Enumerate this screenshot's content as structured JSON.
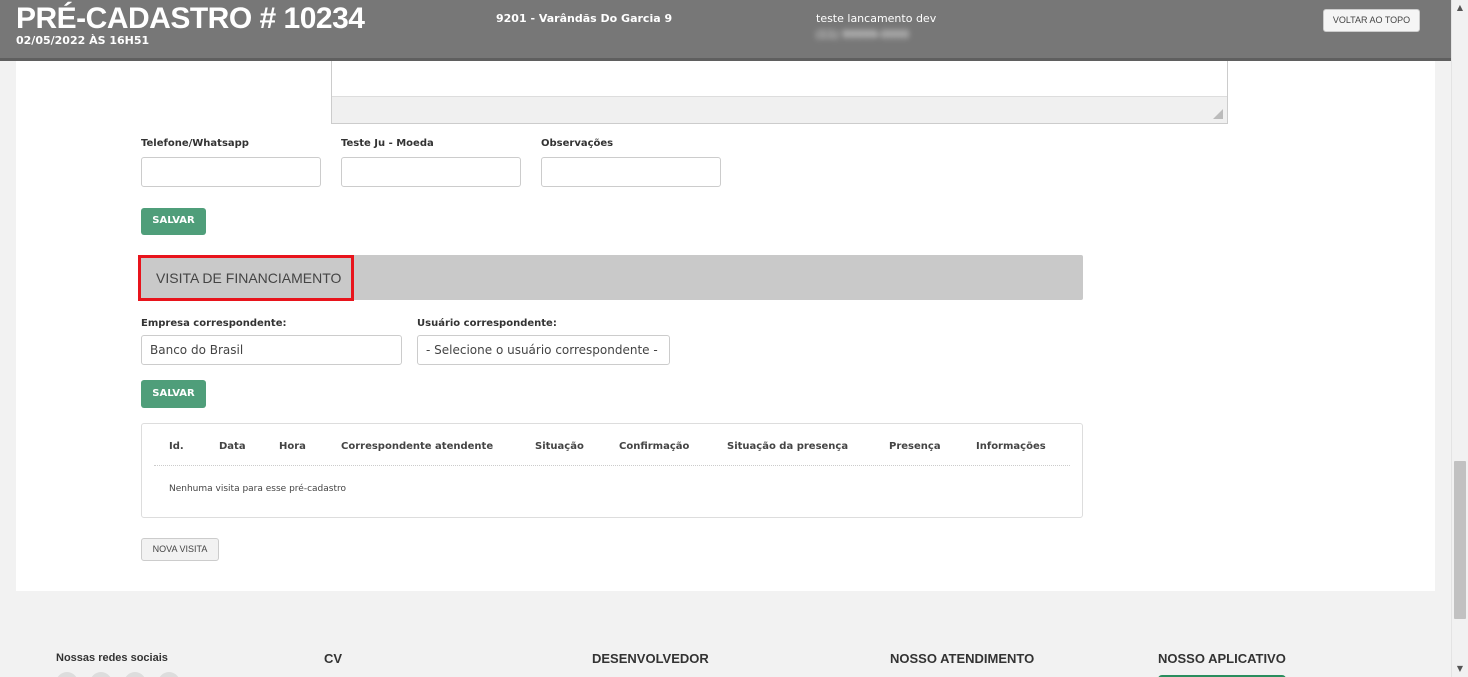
{
  "header": {
    "title": "PRÉ-CADASTRO # 10234",
    "date": "02/05/2022 ÀS 16H51",
    "empreendimento": "9201 - Varândãs Do Garcia 9",
    "client_name": "teste lancamento dev",
    "client_phone": "(11) 99999-0000",
    "back_to_top": "VOLTAR AO TOPO"
  },
  "form": {
    "fields": [
      {
        "label": "Telefone/Whatsapp",
        "value": ""
      },
      {
        "label": "Teste Ju - Moeda",
        "value": ""
      },
      {
        "label": "Observações",
        "value": ""
      }
    ],
    "save_label": "SALVAR"
  },
  "visita": {
    "section_title": "VISITA DE FINANCIAMENTO",
    "empresa_label": "Empresa correspondente:",
    "empresa_value": "Banco do Brasil",
    "usuario_label": "Usuário correspondente:",
    "usuario_value": "- Selecione o usuário correspondente -",
    "save_label": "SALVAR",
    "table": {
      "columns": [
        "Id.",
        "Data",
        "Hora",
        "Correspondente atendente",
        "Situação",
        "Confirmação",
        "Situação da presença",
        "Presença",
        "Informações"
      ],
      "empty_message": "Nenhuma visita para esse pré-cadastro"
    },
    "new_visit_label": "NOVA VISITA"
  },
  "footer": {
    "social_title": "Nossas redes sociais",
    "cv_title": "CV",
    "dev_title": "DESENVOLVEDOR",
    "atendimento_title": "NOSSO ATENDIMENTO",
    "app_title": "NOSSO APLICATIVO"
  },
  "colors": {
    "header_bg": "#777777",
    "accent_green": "#4f9e7a",
    "highlight_red": "#e8141c",
    "section_bg": "#c9c9c9"
  }
}
